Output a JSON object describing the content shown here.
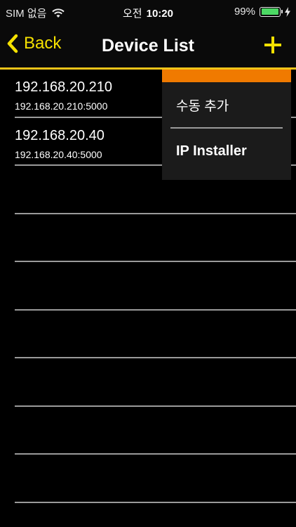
{
  "status": {
    "carrier": "SIM 없음",
    "ampm": "오전",
    "time": "10:20",
    "battery": "99%",
    "battery_level": 0.99,
    "battery_color": "#4cd964"
  },
  "nav": {
    "back_label": "Back",
    "title": "Device List",
    "add_icon": "plus-icon",
    "accent": "#f5e100"
  },
  "devices": [
    {
      "ip": "192.168.20.210",
      "address": "192.168.20.210:5000"
    },
    {
      "ip": "192.168.20.40",
      "address": "192.168.20.40:5000"
    },
    {
      "ip": "",
      "address": ""
    },
    {
      "ip": "",
      "address": ""
    },
    {
      "ip": "",
      "address": ""
    },
    {
      "ip": "",
      "address": ""
    },
    {
      "ip": "",
      "address": ""
    },
    {
      "ip": "",
      "address": ""
    },
    {
      "ip": "",
      "address": ""
    }
  ],
  "menu": {
    "items": [
      {
        "label": "수동 추가"
      },
      {
        "label": "IP Installer"
      }
    ],
    "header_color": "#f07a00"
  }
}
